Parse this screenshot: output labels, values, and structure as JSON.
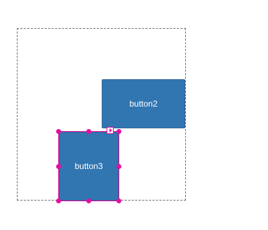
{
  "designer": {
    "buttons": [
      {
        "label": "button2"
      },
      {
        "label": "button3"
      }
    ],
    "selection": {
      "selected_control": "button3",
      "accent_color": "#e40fa2"
    },
    "colors": {
      "button_fill": "#3276b1",
      "surface_border": "#6e6e6e"
    }
  }
}
